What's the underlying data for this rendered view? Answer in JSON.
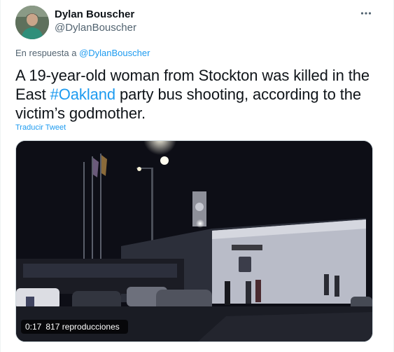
{
  "author": {
    "name": "Dylan Bouscher",
    "handle": "@DylanBouscher"
  },
  "reply": {
    "prefix": "En respuesta a",
    "mention": "@DylanBouscher"
  },
  "tweet": {
    "text_before": "A 19-year-old woman from Stockton was killed in the East ",
    "hashtag": "#Oakland",
    "text_after": " party bus shooting, according to the victim’s godmother."
  },
  "translate_label": "Traducir Tweet",
  "video": {
    "time": "0:17",
    "views": "817 reproducciones"
  },
  "colors": {
    "accent": "#1d9bf0",
    "secondary_text": "#536471",
    "primary_text": "#0f1419"
  },
  "icons": {
    "more": "more-horizontal-icon",
    "avatar": "avatar-image"
  }
}
